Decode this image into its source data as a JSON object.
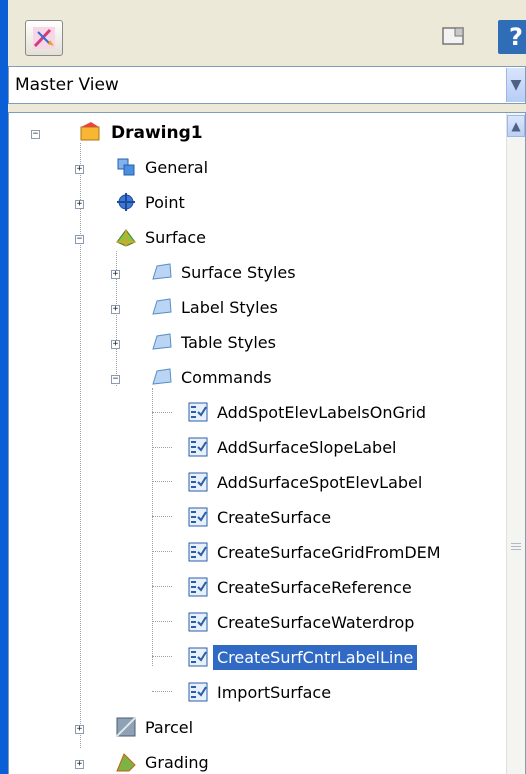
{
  "toolbar": {
    "left_icon": "pick-object-icon",
    "right_icon": "panel-icon",
    "help_label": "?"
  },
  "view_select": {
    "value": "Master View"
  },
  "tree": {
    "root": "Drawing1",
    "general": "General",
    "point": "Point",
    "surface": "Surface",
    "surface_styles": "Surface Styles",
    "label_styles": "Label Styles",
    "table_styles": "Table Styles",
    "commands": "Commands",
    "command_items": [
      "AddSpotElevLabelsOnGrid",
      "AddSurfaceSlopeLabel",
      "AddSurfaceSpotElevLabel",
      "CreateSurface",
      "CreateSurfaceGridFromDEM",
      "CreateSurfaceReference",
      "CreateSurfaceWaterdrop",
      "CreateSurfCntrLabelLine",
      "ImportSurface"
    ],
    "parcel": "Parcel",
    "grading": "Grading"
  },
  "expander_symbols": {
    "plus": "+",
    "minus": "−"
  }
}
